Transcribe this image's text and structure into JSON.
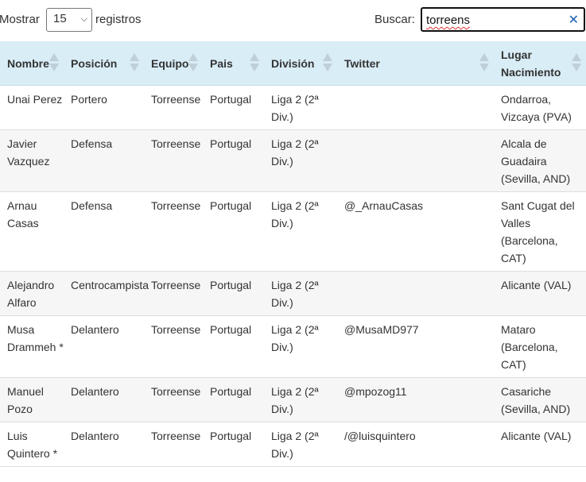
{
  "controls": {
    "show_label": "Mostrar",
    "page_length": "15",
    "records_label": "registros",
    "search_label": "Buscar:",
    "search_value": "torreens",
    "clear_icon": "close-icon"
  },
  "table": {
    "columns": [
      "Nombre",
      "Posición",
      "Equipo",
      "Pais",
      "División",
      "Twitter",
      "Lugar Nacimiento"
    ],
    "rows": [
      {
        "nombre": "Unai Perez",
        "posicion": "Portero",
        "equipo": "Torreense",
        "pais": "Portugal",
        "division": "Liga 2 (2ª Div.)",
        "twitter": "",
        "lugar": "Ondarroa, Vizcaya (PVA)"
      },
      {
        "nombre": "Javier Vazquez",
        "posicion": "Defensa",
        "equipo": "Torreense",
        "pais": "Portugal",
        "division": "Liga 2 (2ª Div.)",
        "twitter": "",
        "lugar": "Alcala de Guadaira (Sevilla, AND)"
      },
      {
        "nombre": "Arnau Casas",
        "posicion": "Defensa",
        "equipo": "Torreense",
        "pais": "Portugal",
        "division": "Liga 2 (2ª Div.)",
        "twitter": "@_ArnauCasas",
        "lugar": "Sant Cugat del Valles (Barcelona, CAT)"
      },
      {
        "nombre": "Alejandro Alfaro",
        "posicion": "Centrocampista",
        "equipo": "Torreense",
        "pais": "Portugal",
        "division": "Liga 2 (2ª Div.)",
        "twitter": "",
        "lugar": "Alicante (VAL)"
      },
      {
        "nombre": "Musa Drammeh *",
        "posicion": "Delantero",
        "equipo": "Torreense",
        "pais": "Portugal",
        "division": "Liga 2 (2ª Div.)",
        "twitter": "@MusaMD977",
        "lugar": "Mataro (Barcelona, CAT)"
      },
      {
        "nombre": "Manuel Pozo",
        "posicion": "Delantero",
        "equipo": "Torreense",
        "pais": "Portugal",
        "division": "Liga 2 (2ª Div.)",
        "twitter": "@mpozog11",
        "lugar": "Casariche (Sevilla, AND)"
      },
      {
        "nombre": "Luis Quintero *",
        "posicion": "Delantero",
        "equipo": "Torreense",
        "pais": "Portugal",
        "division": "Liga 2 (2ª Div.)",
        "twitter": "/@luisquintero",
        "lugar": "Alicante (VAL)"
      }
    ]
  },
  "colors": {
    "header_bg": "#d9edf7",
    "alt_row_bg": "#f6f6f6",
    "clear_icon": "#1a5fb4"
  }
}
